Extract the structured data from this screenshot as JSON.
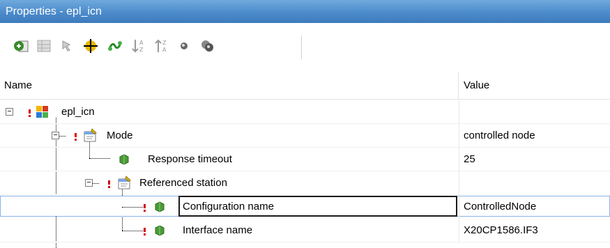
{
  "window": {
    "title": "Properties - epl_icn"
  },
  "toolbar": {
    "buttons": [
      {
        "icon": "add-properties-icon"
      },
      {
        "icon": "grid-icon"
      },
      {
        "icon": "arrow-icon"
      },
      {
        "icon": "target-icon"
      },
      {
        "icon": "connect-icon"
      },
      {
        "icon": "sort-ascending-icon"
      },
      {
        "icon": "sort-descending-icon"
      },
      {
        "icon": "circle-icon"
      },
      {
        "icon": "multi-circle-icon"
      }
    ]
  },
  "columns": {
    "name": "Name",
    "value": "Value"
  },
  "tree": {
    "rows": [
      {
        "label": "epl_icn",
        "value": "",
        "level": 0,
        "icon": "station-icon"
      },
      {
        "label": "Mode",
        "value": "controlled node",
        "level": 1,
        "icon": "settings-icon"
      },
      {
        "label": "Response timeout",
        "value": "25",
        "level": 2,
        "icon": "parameter-icon"
      },
      {
        "label": "Referenced station",
        "value": "",
        "level": 2,
        "icon": "settings-icon"
      },
      {
        "label": "Configuration name",
        "value": "ControlledNode",
        "level": 3,
        "icon": "parameter-icon",
        "selected": true
      },
      {
        "label": "Interface name",
        "value": "X20CP1586.IF3",
        "level": 3,
        "icon": "parameter-icon"
      }
    ]
  },
  "colors": {
    "title_bar": "#4c8bcc",
    "warning": "#d40000",
    "selection_border": "#8ab4ea",
    "param_green": "#4c9a3a"
  }
}
